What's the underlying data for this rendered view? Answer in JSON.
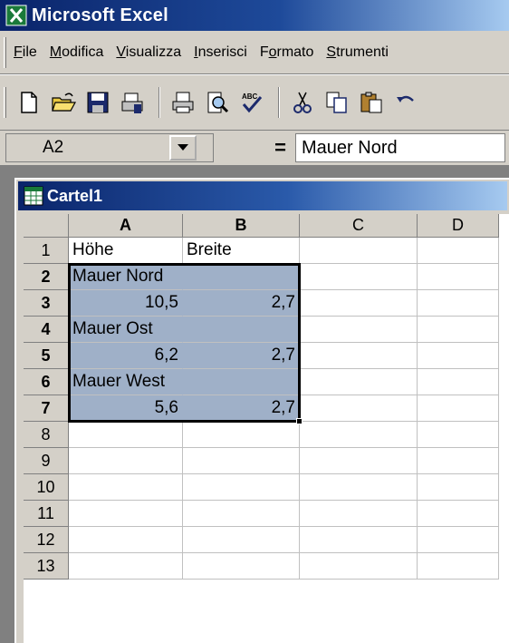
{
  "app": {
    "title": "Microsoft Excel"
  },
  "menu": [
    {
      "label": "File",
      "accel": "F",
      "rest": "ile"
    },
    {
      "label": "Modifica",
      "accel": "M",
      "rest": "odifica"
    },
    {
      "label": "Visualizza",
      "accel": "V",
      "rest": "isualizza"
    },
    {
      "label": "Inserisci",
      "accel": "I",
      "rest": "nserisci"
    },
    {
      "label": "Formato",
      "pre": "F",
      "accel": "o",
      "rest": "rmato"
    },
    {
      "label": "Strumenti",
      "accel": "S",
      "rest": "trumenti"
    }
  ],
  "formula_bar": {
    "name_box": "A2",
    "equals": "=",
    "content": "Mauer Nord"
  },
  "workbook": {
    "title": "Cartel1"
  },
  "sheet": {
    "columns": [
      "A",
      "B",
      "C",
      "D"
    ],
    "rows": [
      "1",
      "2",
      "3",
      "4",
      "5",
      "6",
      "7",
      "8",
      "9",
      "10",
      "11",
      "12",
      "13"
    ],
    "cells": {
      "A1": "Höhe",
      "B1": "Breite",
      "A2": "Mauer Nord",
      "A3": "10,5",
      "B3": "2,7",
      "A4": "Mauer Ost",
      "A5": "6,2",
      "B5": "2,7",
      "A6": "Mauer West",
      "A7": "5,6",
      "B7": "2,7"
    },
    "selection": "A2:B7",
    "highlight_color": "#9fb0c8"
  },
  "icons": [
    "excel-icon",
    "new-icon",
    "open-icon",
    "save-icon",
    "print-setup-icon",
    "print-icon",
    "print-preview-icon",
    "spelling-icon",
    "cut-icon",
    "copy-icon",
    "paste-icon",
    "undo-icon",
    "dropdown-arrow-icon",
    "workbook-icon"
  ]
}
